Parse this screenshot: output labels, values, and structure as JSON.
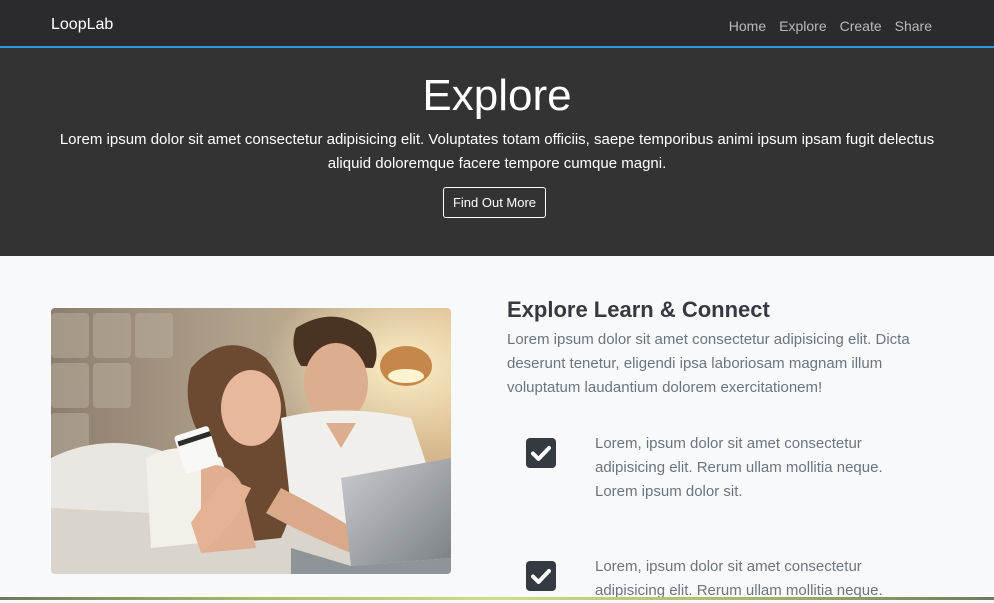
{
  "navbar": {
    "brand": "LoopLab",
    "links": [
      "Home",
      "Explore",
      "Create",
      "Share"
    ],
    "accent_color": "#2d9ad8"
  },
  "hero": {
    "title": "Explore",
    "lead": "Lorem ipsum dolor sit amet consectetur adipisicing elit. Voluptates totam officiis, saepe temporibus animi ipsum ipsam fugit delectus aliquid doloremque facere tempore cumque magni.",
    "button_label": "Find Out More"
  },
  "section": {
    "image_icon": "couple-shopping-photo",
    "title": "Explore Learn & Connect",
    "text": "Lorem ipsum dolor sit amet consectetur adipisicing elit. Dicta deserunt tenetur, eligendi ipsa laboriosam magnam illum voluptatum laudantium dolorem exercitationem!",
    "items": [
      {
        "icon": "check-square-icon",
        "text": "Lorem, ipsum dolor sit amet consectetur adipisicing elit. Rerum ullam mollitia neque. Lorem ipsum dolor sit."
      },
      {
        "icon": "check-square-icon",
        "text": "Lorem, ipsum dolor sit amet consectetur adipisicing elit. Rerum ullam mollitia neque."
      }
    ]
  }
}
